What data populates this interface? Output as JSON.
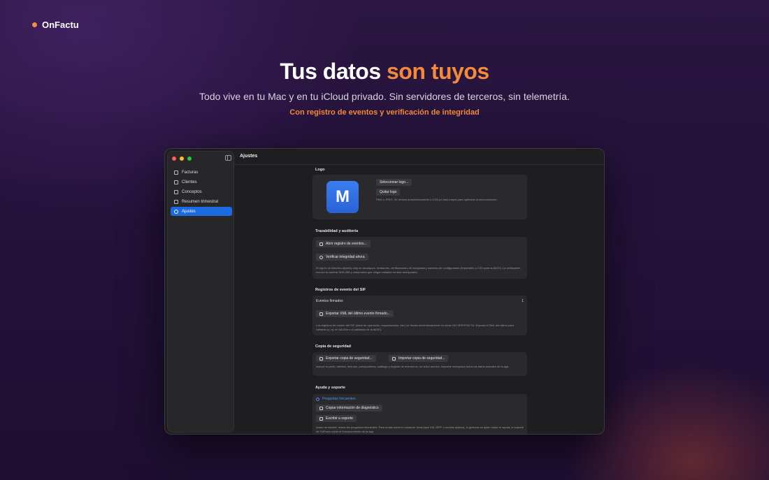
{
  "brand": {
    "name": "OnFactu",
    "dot_color": "#f0913f"
  },
  "hero": {
    "title_main": "Tus datos",
    "title_accent": "son tuyos",
    "subtitle": "Todo vive en tu Mac y en tu iCloud privado. Sin servidores de terceros, sin telemetría.",
    "tagline": "Con registro de eventos y verificación de integridad",
    "accent_color": "#f28a3a"
  },
  "window": {
    "title": "Ajustes",
    "sidebar": {
      "items": [
        {
          "label": "Facturas",
          "icon": "document-icon",
          "active": false
        },
        {
          "label": "Clientes",
          "icon": "people-icon",
          "active": false
        },
        {
          "label": "Conceptos",
          "icon": "list-icon",
          "active": false
        },
        {
          "label": "Resumen trimestral",
          "icon": "chart-icon",
          "active": false
        },
        {
          "label": "Ajustes",
          "icon": "gear-icon",
          "active": true
        }
      ]
    },
    "sections": {
      "logo": {
        "title": "Logo",
        "logo_letter": "M",
        "select_button": "Seleccionar logo...",
        "remove_button": "Quitar logo",
        "hint": "PNG o JPEG. Se reduce automáticamente a 1024 px lado mayor para optimizar la sincronización."
      },
      "trace": {
        "title": "Trazabilidad y auditoría",
        "open_log_button": "Abrir registro de eventos...",
        "verify_button": "Verificar integridad ahora",
        "hint": "El log es un histórico append-only de arranques, emisiones, verificaciones de integridad y cambios de configuración (exportable a CSV para la AEAT). La verificación recorre la cadena SHA-256 y comprueba que ningún eslabón ha sido manipulado."
      },
      "sif": {
        "title": "Registros de evento del SIF",
        "signed_label": "Eventos firmados",
        "signed_count": "1",
        "export_button": "Exportar XML del último evento firmado...",
        "hint": "Los registros de evento del SIF (inicio de operación, exportaciones, etc.) se firman electrónicamente en modo NO VERI*FACTU. Exporta el XML del último para validarlo (p. ej. en VALIDe o el validador de la AEAT)."
      },
      "backup": {
        "title": "Copia de seguridad",
        "export_button": "Exportar copia de seguridad...",
        "import_button": "Importar copia de seguridad...",
        "hint": "Incluye tu perfil, clientes, facturas, presupuestos, catálogo y registro de eventos en un único archivo. Importar reemplaza todos los datos actuales de la app."
      },
      "support": {
        "title": "Ayuda y soporte",
        "faq_link": "Preguntas frecuentes",
        "copy_diag_button": "Copiar información de diagnóstico",
        "write_support_button": "Escribir a soporte",
        "hint": "Antes de escribir, revisa las preguntas frecuentes. Para dudas sobre tu situación fiscal (qué IVA, IRPF o modelo aplicar), tu gestoría es quien mejor te ayuda; el soporte de OnFactu cubre el funcionamiento de la app."
      }
    }
  }
}
